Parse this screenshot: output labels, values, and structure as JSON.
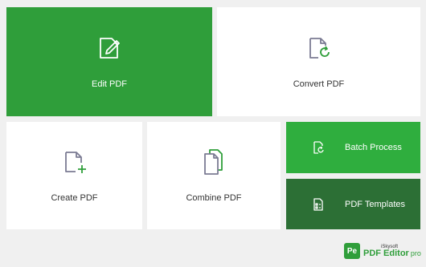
{
  "tiles": {
    "edit_pdf": "Edit PDF",
    "convert_pdf": "Convert PDF",
    "create_pdf": "Create PDF",
    "combine_pdf": "Combine PDF",
    "batch_process": "Batch Process",
    "pdf_templates": "PDF Templates"
  },
  "icons": {
    "edit_pdf": "document-edit-icon",
    "convert_pdf": "document-convert-icon",
    "create_pdf": "document-add-icon",
    "combine_pdf": "documents-stack-icon",
    "batch_process": "batch-refresh-icon",
    "pdf_templates": "template-document-icon"
  },
  "brand": {
    "logo_text": "Pe",
    "company": "iSkysoft",
    "product": "PDF Editor",
    "edition": "pro"
  },
  "colors": {
    "green": "#2f9e3a",
    "green_light": "#2fae3e",
    "green_dark": "#2c6f35",
    "icon_gray": "#7b7b93",
    "accent_plus": "#2f9e3a"
  }
}
